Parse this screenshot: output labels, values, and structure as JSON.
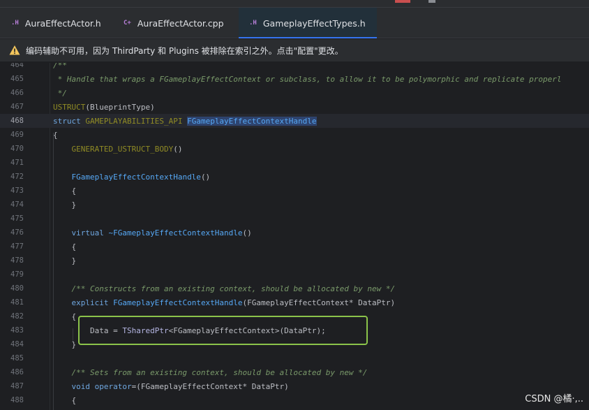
{
  "tabs": [
    {
      "ext": ".H",
      "ext_color": "#b87fd9",
      "label": "AuraEffectActor.h",
      "active": false
    },
    {
      "ext": "C+",
      "ext_color": "#b87fd9",
      "label": "AuraEffectActor.cpp",
      "active": false
    },
    {
      "ext": ".H",
      "ext_color": "#b87fd9",
      "label": "GameplayEffectTypes.h",
      "active": true
    }
  ],
  "banner": {
    "icon": "warning-icon",
    "message": "编码辅助不可用，因为 ThirdParty 和 Plugins 被排除在索引之外。点击\"配置\"更改。"
  },
  "editor": {
    "current_line": "468",
    "lines": [
      {
        "n": "464",
        "code": "/**"
      },
      {
        "n": "465",
        "code": " * Handle that wraps a FGameplayEffectContext or subclass, to allow it to be polymorphic and replicate properl"
      },
      {
        "n": "466",
        "code": " */"
      },
      {
        "n": "467",
        "code": "USTRUCT(BlueprintType)"
      },
      {
        "n": "468",
        "code": "struct GAMEPLAYABILITIES_API FGameplayEffectContextHandle"
      },
      {
        "n": "469",
        "code": "{"
      },
      {
        "n": "470",
        "code": "    GENERATED_USTRUCT_BODY()"
      },
      {
        "n": "471",
        "code": ""
      },
      {
        "n": "472",
        "code": "    FGameplayEffectContextHandle()"
      },
      {
        "n": "473",
        "code": "    {"
      },
      {
        "n": "474",
        "code": "    }"
      },
      {
        "n": "475",
        "code": ""
      },
      {
        "n": "476",
        "code": "    virtual ~FGameplayEffectContextHandle()"
      },
      {
        "n": "477",
        "code": "    {"
      },
      {
        "n": "478",
        "code": "    }"
      },
      {
        "n": "479",
        "code": ""
      },
      {
        "n": "480",
        "code": "    /** Constructs from an existing context, should be allocated by new */"
      },
      {
        "n": "481",
        "code": "    explicit FGameplayEffectContextHandle(FGameplayEffectContext* DataPtr)"
      },
      {
        "n": "482",
        "code": "    {"
      },
      {
        "n": "483",
        "code": "        Data = TSharedPtr<FGameplayEffectContext>(DataPtr);"
      },
      {
        "n": "484",
        "code": "    }"
      },
      {
        "n": "485",
        "code": ""
      },
      {
        "n": "486",
        "code": "    /** Sets from an existing context, should be allocated by new */"
      },
      {
        "n": "487",
        "code": "    void operator=(FGameplayEffectContext* DataPtr)"
      },
      {
        "n": "488",
        "code": "    {"
      }
    ]
  },
  "watermark": "CSDN @橘·,..",
  "colors": {
    "highlight_box": "#8bc34a",
    "tab_accent": "#3574f0",
    "warning": "#f2c55c"
  }
}
